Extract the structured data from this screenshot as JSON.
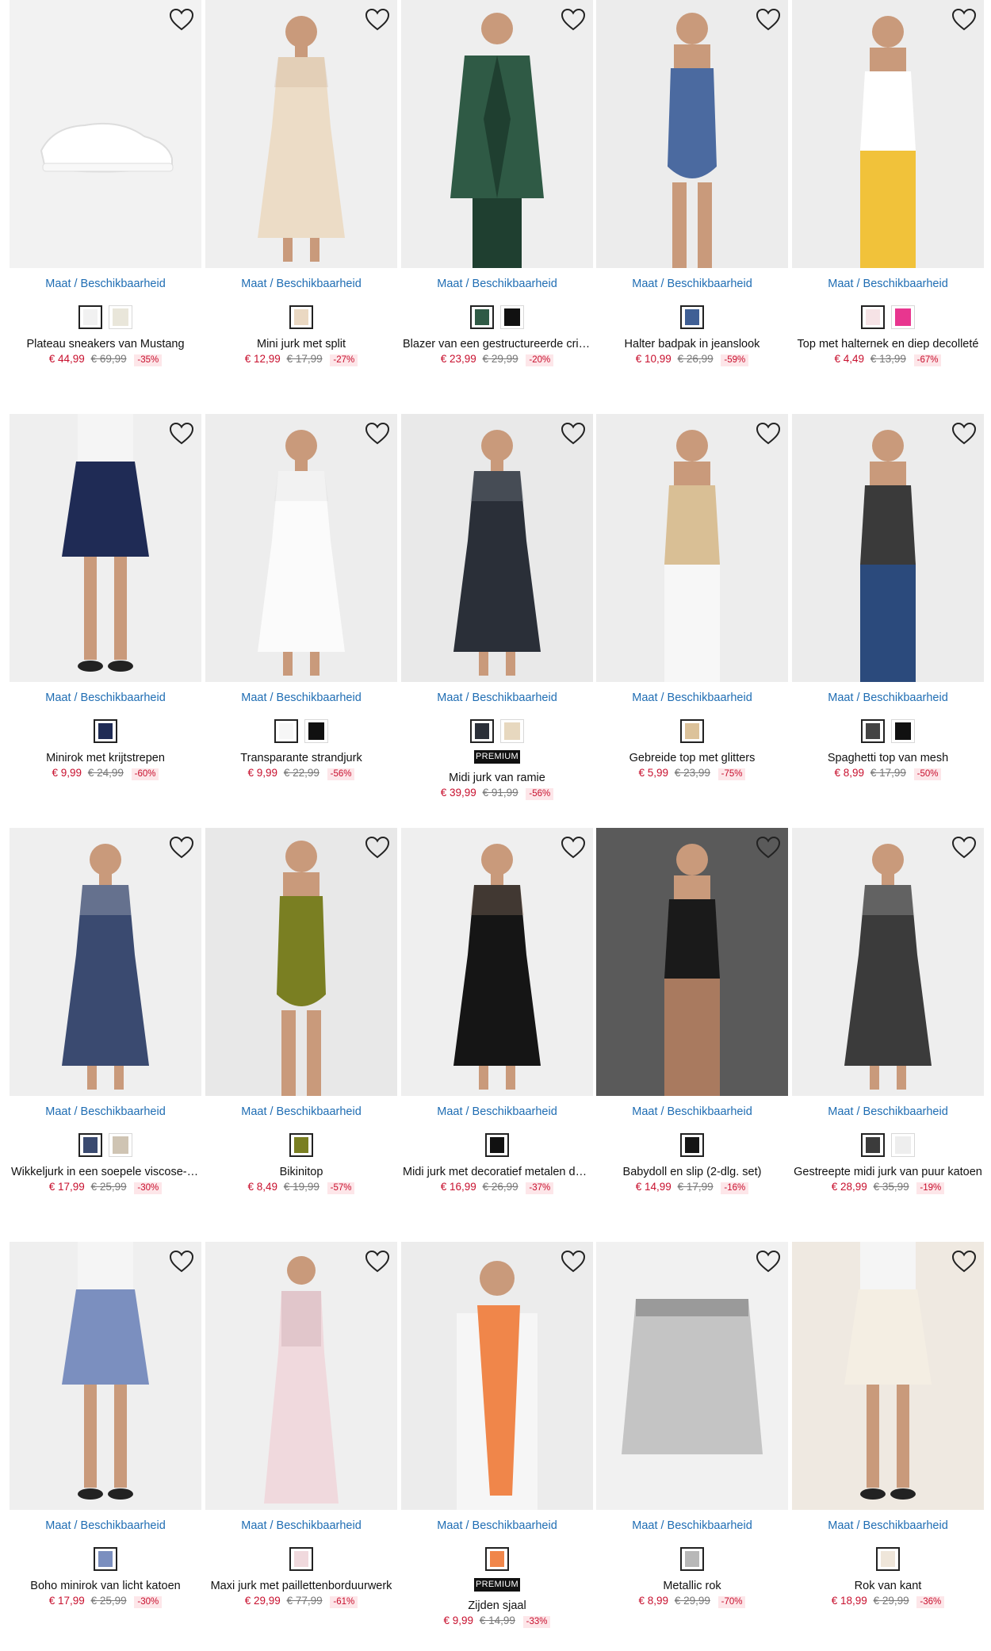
{
  "availability_label": "Maat / Beschikbaarheid",
  "premium_label": "PREMIUM",
  "products": [
    {
      "name": "Plateau sneakers van Mustang",
      "price": "€ 44,99",
      "old_price": "€ 69,99",
      "discount": "-35%",
      "image": "white-sneaker",
      "premium": false,
      "swatches": [
        {
          "color": "#f1f1f1",
          "selected": true
        },
        {
          "color": "#e9e6da",
          "selected": false
        }
      ]
    },
    {
      "name": "Mini jurk met split",
      "price": "€ 12,99",
      "old_price": "€ 17,99",
      "discount": "-27%",
      "image": "beige-dress",
      "premium": false,
      "swatches": [
        {
          "color": "#ead8c2",
          "selected": true
        }
      ]
    },
    {
      "name": "Blazer van een gestructureerde crinkle kwaliteit",
      "price": "€ 23,99",
      "old_price": "€ 29,99",
      "discount": "-20%",
      "image": "green-blazer",
      "premium": false,
      "swatches": [
        {
          "color": "#2f5a45",
          "selected": true
        },
        {
          "color": "#111111",
          "selected": false
        }
      ]
    },
    {
      "name": "Halter badpak in jeanslook",
      "price": "€ 10,99",
      "old_price": "€ 26,99",
      "discount": "-59%",
      "image": "blue-swimsuit",
      "premium": false,
      "swatches": [
        {
          "color": "#3f5f95",
          "selected": true
        }
      ]
    },
    {
      "name": "Top met halternek en diep decolleté",
      "price": "€ 4,49",
      "old_price": "€ 13,99",
      "discount": "-67%",
      "image": "white-halter-top",
      "premium": false,
      "swatches": [
        {
          "color": "#f6e3e6",
          "selected": true
        },
        {
          "color": "#e8368f",
          "selected": false
        }
      ]
    },
    {
      "name": "Minirok met krijtstrepen",
      "price": "€ 9,99",
      "old_price": "€ 24,99",
      "discount": "-60%",
      "image": "navy-skirt",
      "premium": false,
      "swatches": [
        {
          "color": "#1f2b55",
          "selected": true
        }
      ]
    },
    {
      "name": "Transparante strandjurk",
      "price": "€ 9,99",
      "old_price": "€ 22,99",
      "discount": "-56%",
      "image": "white-beach-dress",
      "premium": false,
      "swatches": [
        {
          "color": "#f6f6f6",
          "selected": true
        },
        {
          "color": "#111111",
          "selected": false
        }
      ]
    },
    {
      "name": "Midi jurk van ramie",
      "price": "€ 39,99",
      "old_price": "€ 91,99",
      "discount": "-56%",
      "image": "palm-print-dress",
      "premium": true,
      "swatches": [
        {
          "color": "#2a2f38",
          "selected": true
        },
        {
          "color": "#e7d8bf",
          "selected": false
        }
      ]
    },
    {
      "name": "Gebreide top met glitters",
      "price": "€ 5,99",
      "old_price": "€ 23,99",
      "discount": "-75%",
      "image": "knit-top",
      "premium": false,
      "swatches": [
        {
          "color": "#dcc29a",
          "selected": true
        }
      ]
    },
    {
      "name": "Spaghetti top van mesh",
      "price": "€ 8,99",
      "old_price": "€ 17,99",
      "discount": "-50%",
      "image": "black-mesh-top",
      "premium": false,
      "swatches": [
        {
          "color": "#444444",
          "selected": true
        },
        {
          "color": "#111111",
          "selected": false
        }
      ]
    },
    {
      "name": "Wikkeljurk in een soepele viscose-elastaan kwaliteit",
      "price": "€ 17,99",
      "old_price": "€ 25,99",
      "discount": "-30%",
      "image": "striped-wrap-dress",
      "premium": false,
      "swatches": [
        {
          "color": "#3a4a70",
          "selected": true
        },
        {
          "color": "#cfc4b3",
          "selected": false
        }
      ]
    },
    {
      "name": "Bikinitop",
      "price": "€ 8,49",
      "old_price": "€ 19,99",
      "discount": "-57%",
      "image": "olive-bikini",
      "premium": false,
      "swatches": [
        {
          "color": "#7a7f22",
          "selected": true
        }
      ]
    },
    {
      "name": "Midi jurk met decoratief metalen detail",
      "price": "€ 16,99",
      "old_price": "€ 26,99",
      "discount": "-37%",
      "image": "black-halter-dress",
      "premium": false,
      "swatches": [
        {
          "color": "#111111",
          "selected": true
        }
      ]
    },
    {
      "name": "Babydoll en slip (2-dlg. set)",
      "price": "€ 14,99",
      "old_price": "€ 17,99",
      "discount": "-16%",
      "image": "black-babydoll",
      "premium": false,
      "swatches": [
        {
          "color": "#151515",
          "selected": true
        }
      ]
    },
    {
      "name": "Gestreepte midi jurk van puur katoen",
      "price": "€ 28,99",
      "old_price": "€ 35,99",
      "discount": "-19%",
      "image": "striped-midi-dress",
      "premium": false,
      "swatches": [
        {
          "color": "#3b3b3b",
          "selected": true
        },
        {
          "color": "#eeeeee",
          "selected": false
        }
      ]
    },
    {
      "name": "Boho minirok van licht katoen",
      "price": "€ 17,99",
      "old_price": "€ 25,99",
      "discount": "-30%",
      "image": "floral-skirt",
      "premium": false,
      "swatches": [
        {
          "color": "#7b8fbf",
          "selected": true
        }
      ]
    },
    {
      "name": "Maxi jurk met paillettenborduurwerk",
      "price": "€ 29,99",
      "old_price": "€ 77,99",
      "discount": "-61%",
      "image": "pink-maxi-dress",
      "premium": false,
      "swatches": [
        {
          "color": "#f0d9dd",
          "selected": true
        }
      ]
    },
    {
      "name": "Zijden sjaal",
      "price": "€ 9,99",
      "old_price": "€ 14,99",
      "discount": "-33%",
      "image": "orange-silk-scarf",
      "premium": true,
      "swatches": [
        {
          "color": "#f0864a",
          "selected": true
        }
      ]
    },
    {
      "name": "Metallic rok",
      "price": "€ 8,99",
      "old_price": "€ 29,99",
      "discount": "-70%",
      "image": "silver-skirt",
      "premium": false,
      "swatches": [
        {
          "color": "#b8b8b8",
          "selected": true
        }
      ]
    },
    {
      "name": "Rok van kant",
      "price": "€ 18,99",
      "old_price": "€ 29,99",
      "discount": "-36%",
      "image": "lace-skirt",
      "premium": false,
      "swatches": [
        {
          "color": "#efe6da",
          "selected": true
        }
      ]
    }
  ]
}
